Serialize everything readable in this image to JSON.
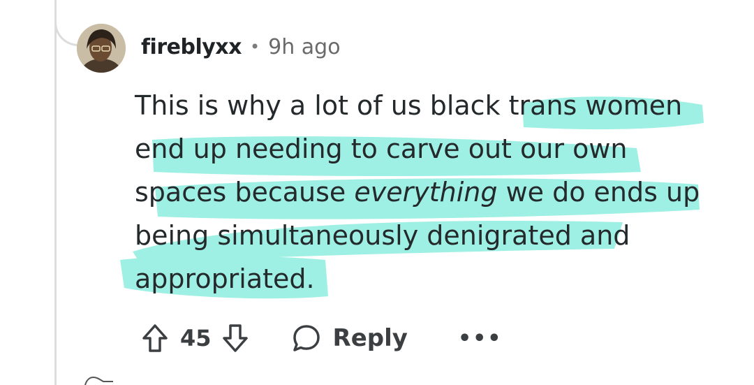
{
  "comment": {
    "username": "fireblyxx",
    "separator": "•",
    "time_ago": "9h ago",
    "body": {
      "part1": "This is why a lot of us black trans women end up needing to carve out our own spaces because ",
      "emphasis": "everything",
      "part2": " we do ends up being simultaneously denigrated and appropriated."
    },
    "score": "45",
    "reply_label": "Reply",
    "more_label": "•••",
    "highlight_color": "#9ff0e4"
  },
  "icons": {
    "upvote": "arrow-up-outline",
    "downvote": "arrow-down-outline",
    "reply": "speech-bubble",
    "more": "ellipsis"
  }
}
